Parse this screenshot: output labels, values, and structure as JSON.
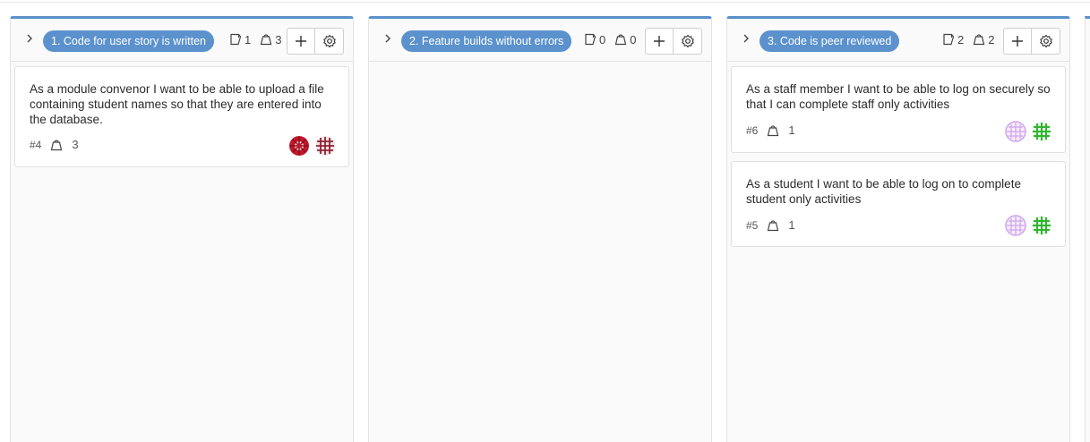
{
  "columns": [
    {
      "title": "1. Code for user story is written",
      "item_count": "1",
      "weight_count": "3",
      "cards": [
        {
          "title": "As a module convenor I want to be able to upload a file containing student names so that they are entered into the database.",
          "id": "#4",
          "weight": "3",
          "assignees": [
            "red-avatar",
            "maroon-avatar"
          ]
        }
      ]
    },
    {
      "title": "2. Feature builds without errors",
      "item_count": "0",
      "weight_count": "0",
      "cards": []
    },
    {
      "title": "3. Code is peer reviewed",
      "item_count": "2",
      "weight_count": "2",
      "cards": [
        {
          "title": "As a staff member I want to be able to log on securely so that I can complete staff only activities",
          "id": "#6",
          "weight": "1",
          "assignees": [
            "lilac-avatar",
            "green-avatar"
          ]
        },
        {
          "title": "As a student I want to be able to log on to complete student only activities",
          "id": "#5",
          "weight": "1",
          "assignees": [
            "lilac-avatar",
            "green-avatar"
          ]
        }
      ]
    }
  ],
  "icons": {
    "expand": "chevron-right-icon",
    "items": "issues-icon",
    "weight": "weight-icon",
    "add": "plus-icon",
    "settings": "gear-icon"
  },
  "colors": {
    "accent": "#5a8fc9",
    "label_bg": "#5b92cd",
    "avatar_red": "#c0172a",
    "avatar_maroon": "#8e2436",
    "avatar_lilac": "#cda4e8",
    "avatar_green": "#2fb52f"
  }
}
